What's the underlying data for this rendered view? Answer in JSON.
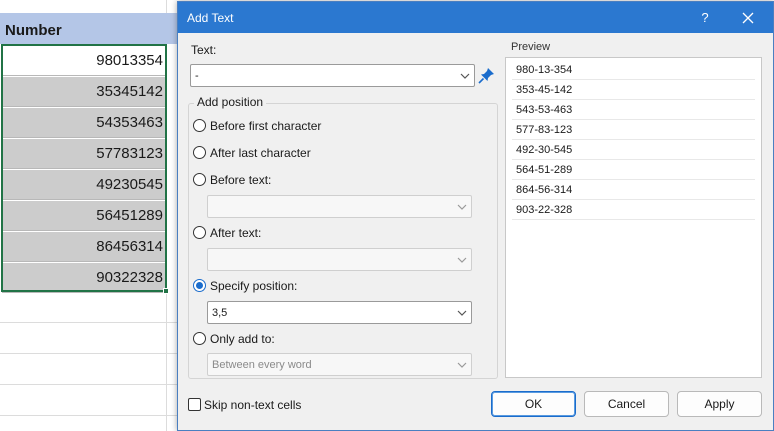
{
  "sheet": {
    "column_header": "Number",
    "cells": [
      "98013354",
      "35345142",
      "54353463",
      "57783123",
      "49230545",
      "56451289",
      "86456314",
      "90322328"
    ]
  },
  "dialog": {
    "title": "Add Text",
    "help": "?",
    "text_label": "Text:",
    "text_value": "-",
    "add_position_label": "Add position",
    "options": {
      "before_first": "Before first character",
      "after_last": "After last character",
      "before_text": "Before text:",
      "after_text": "After text:",
      "specify_position": "Specify position:",
      "only_add_to": "Only add to:"
    },
    "specify_position_value": "3,5",
    "only_add_to_value": "Between every word",
    "selected_option": "specify_position",
    "preview_label": "Preview",
    "preview_rows": [
      "980-13-354",
      "353-45-142",
      "543-53-463",
      "577-83-123",
      "492-30-545",
      "564-51-289",
      "864-56-314",
      "903-22-328"
    ],
    "skip_label": "Skip non-text cells",
    "ok_label": "OK",
    "cancel_label": "Cancel",
    "apply_label": "Apply"
  },
  "colors": {
    "title_bar": "#2b78d0",
    "accent": "#1a6ccc",
    "header_fill": "#b4c6e7",
    "selection_border": "#217346"
  }
}
